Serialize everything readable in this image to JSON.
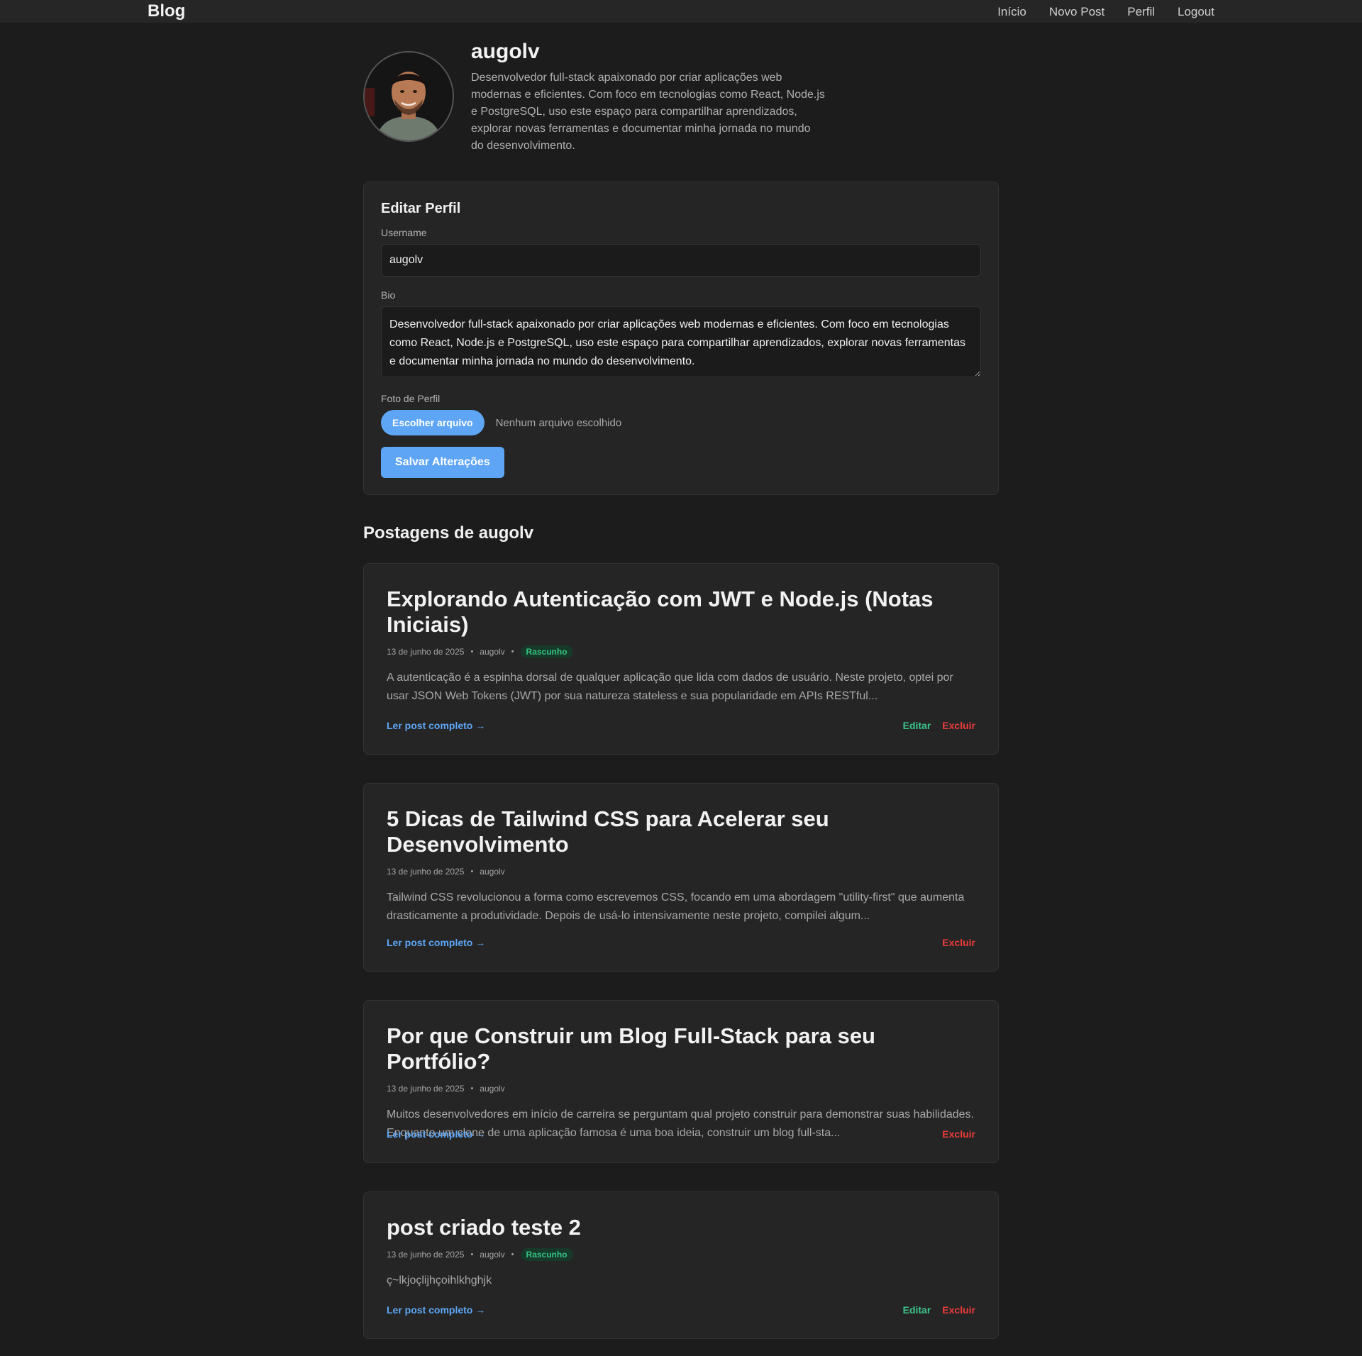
{
  "navbar": {
    "brand": "Blog",
    "links": [
      "Início",
      "Novo Post",
      "Perfil",
      "Logout"
    ]
  },
  "profile": {
    "username": "augolv",
    "bio": "Desenvolvedor full-stack apaixonado por criar aplicações web modernas e eficientes. Com foco em tecnologias como React, Node.js e PostgreSQL, uso este espaço para compartilhar aprendizados, explorar novas ferramentas e documentar minha jornada no mundo do desenvolvimento."
  },
  "edit_form": {
    "title": "Editar Perfil",
    "username_label": "Username",
    "username_value": "augolv",
    "bio_label": "Bio",
    "bio_value": "Desenvolvedor full-stack apaixonado por criar aplicações web modernas e eficientes. Com foco em tecnologias como React, Node.js e PostgreSQL, uso este espaço para compartilhar aprendizados, explorar novas ferramentas e documentar minha jornada no mundo do desenvolvimento.",
    "photo_label": "Foto de Perfil",
    "file_button": "Escolher arquivo",
    "file_status": "Nenhum arquivo escolhido",
    "save_button": "Salvar Alterações"
  },
  "posts_section": {
    "title": "Postagens de augolv"
  },
  "posts": [
    {
      "title": "Explorando Autenticação com JWT e Node.js (Notas Iniciais)",
      "date": "13 de junho de 2025",
      "author": "augolv",
      "badge": "Rascunho",
      "excerpt": "A autenticação é a espinha dorsal de qualquer aplicação que lida com dados de usuário. Neste projeto, optei por usar JSON Web Tokens (JWT) por sua natureza stateless e sua popularidade em APIs RESTful...",
      "read_more": "Ler post completo →",
      "edit": "Editar",
      "delete": "Excluir"
    },
    {
      "title": "5 Dicas de Tailwind CSS para Acelerar seu Desenvolvimento",
      "date": "13 de junho de 2025",
      "author": "augolv",
      "excerpt": "Tailwind CSS revolucionou a forma como escrevemos CSS, focando em uma abordagem \"utility-first\" que aumenta drasticamente a produtividade. Depois de usá-lo intensivamente neste projeto, compilei algum...",
      "read_more": "Ler post completo →",
      "delete": "Excluir"
    },
    {
      "title": "Por que Construir um Blog Full-Stack para seu Portfólio?",
      "date": "13 de junho de 2025",
      "author": "augolv",
      "excerpt": "Muitos desenvolvedores em início de carreira se perguntam qual projeto construir para demonstrar suas habilidades. Enquanto um clone de uma aplicação famosa é uma boa ideia, construir um blog full-sta...",
      "read_more": "Ler post completo →",
      "delete": "Excluir"
    },
    {
      "title": "post criado teste 2",
      "date": "13 de junho de 2025",
      "author": "augolv",
      "badge": "Rascunho",
      "excerpt": "ç~lkjoçlijhçoihlkhghjk",
      "read_more": "Ler post completo →",
      "edit": "Editar",
      "delete": "Excluir"
    }
  ],
  "colors": {
    "background": "#1c1c1c",
    "card": "#252525",
    "accent_blue": "#5ea6f5",
    "edit_green": "#3bc489",
    "delete_red": "#ef3b3b",
    "badge_text": "#34c381"
  }
}
